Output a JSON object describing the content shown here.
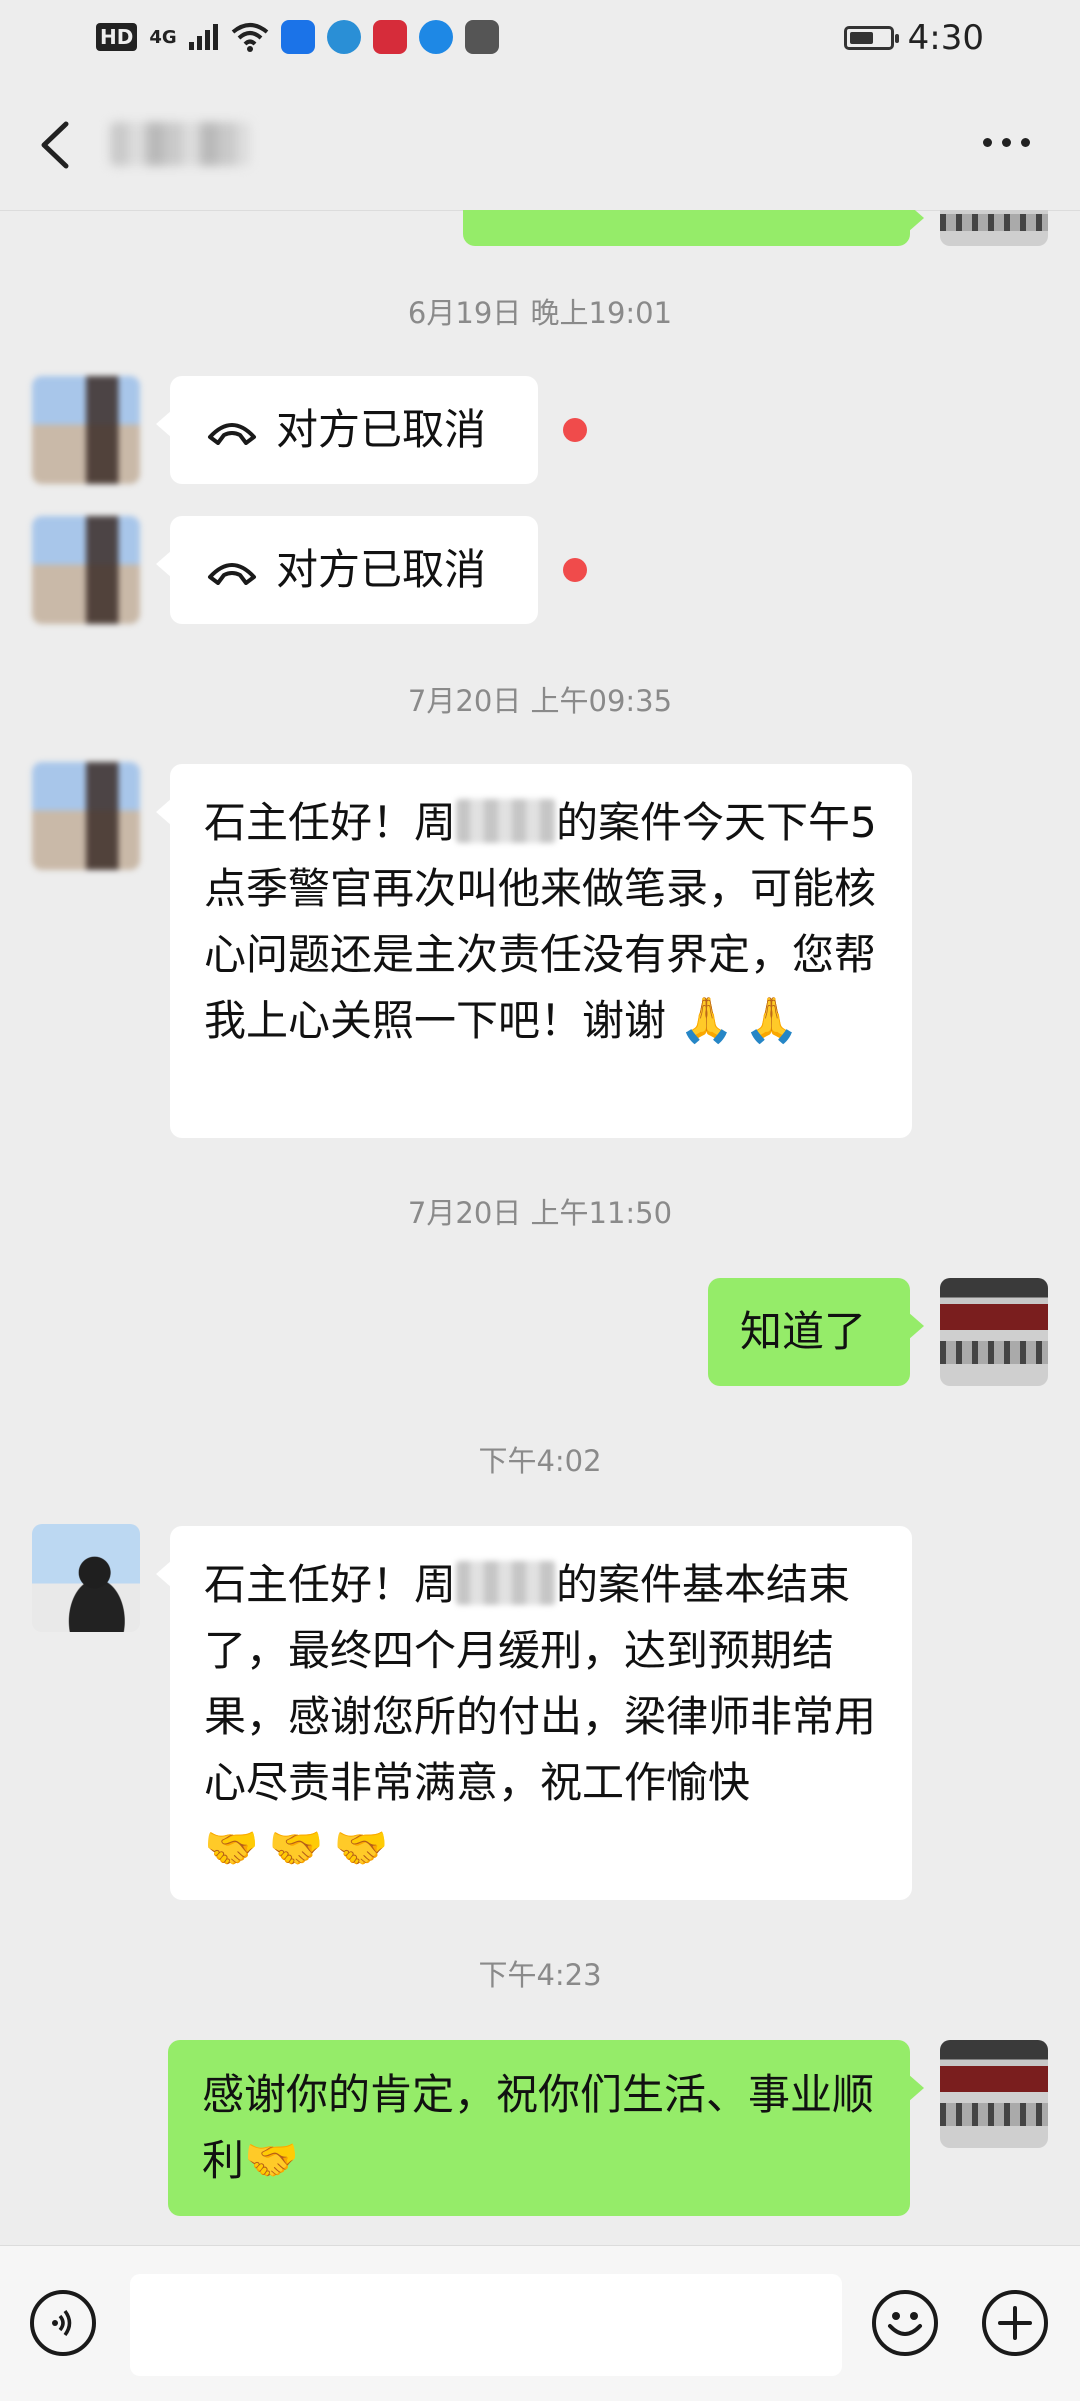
{
  "status_bar": {
    "network_label": "HD",
    "signal_label": "4G",
    "time": "4:30",
    "battery_level": 0.6,
    "app_icons": [
      "browser-icon",
      "weibo-icon",
      "reader-icon",
      "app-icon",
      "hms-icon"
    ]
  },
  "header": {
    "back_icon": "chevron-left-icon",
    "more_icon": "more-dots-icon"
  },
  "messages": {
    "ts1": "6月19日 晚上19:01",
    "call1": "对方已取消",
    "call2": "对方已取消",
    "ts2": "7月20日 上午09:35",
    "msg1_before": "石主任好！周",
    "msg1_after": "的案件今天下午5点季警官再次叫他来做笔录，可能核心问题还是主次责任没有界定，您帮我上心关照一下吧！谢谢",
    "msg1_emojis": [
      "🙏",
      "🙏"
    ],
    "ts3": "7月20日 上午11:50",
    "reply1": "知道了",
    "ts4": "下午4:02",
    "msg2_before": "石主任好！周",
    "msg2_after": "的案件基本结束了，最终四个月缓刑，达到预期结果，感谢您所的付出，梁律师非常用心尽责非常满意，祝工作愉快",
    "msg2_emojis": [
      "🤝",
      "🤝",
      "🤝"
    ],
    "ts5": "下午4:23",
    "reply2": "感谢你的肯定，祝你们生活、事业顺利",
    "reply2_emoji": "🤝"
  },
  "colors": {
    "background": "#ededed",
    "sent_bubble": "#95ec69",
    "received_bubble": "#ffffff",
    "unread_dot": "#f04b4b"
  }
}
